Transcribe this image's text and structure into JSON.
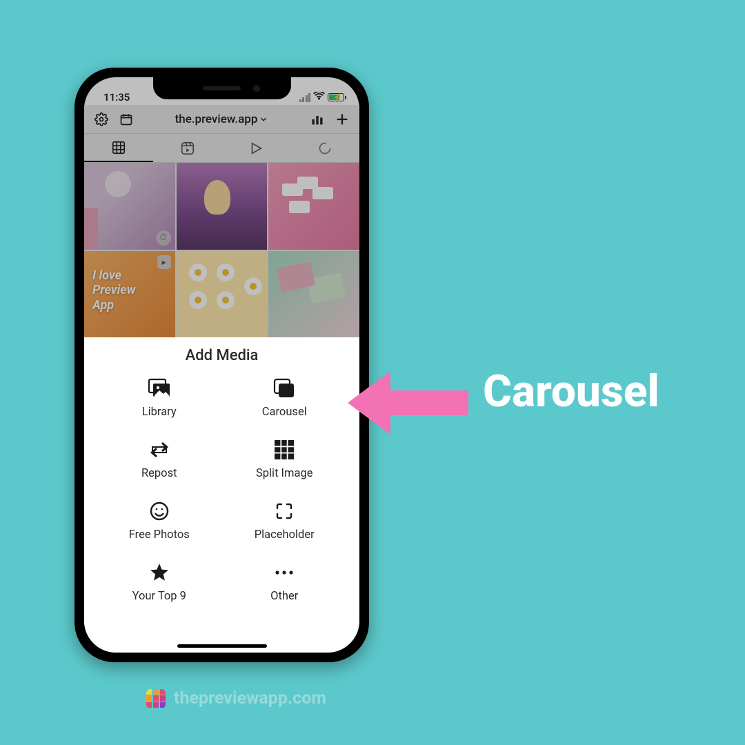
{
  "status": {
    "time": "11:35"
  },
  "toolbar": {
    "title": "the.preview.app"
  },
  "sheet": {
    "title": "Add Media",
    "items": [
      {
        "label": "Library"
      },
      {
        "label": "Carousel"
      },
      {
        "label": "Repost"
      },
      {
        "label": "Split Image"
      },
      {
        "label": "Free Photos"
      },
      {
        "label": "Placeholder"
      },
      {
        "label": "Your Top 9"
      },
      {
        "label": "Other"
      }
    ]
  },
  "feed_overlay_text": "I love\nPreview\nApp",
  "callout": {
    "label": "Carousel"
  },
  "footer": {
    "text": "thepreviewapp.com"
  }
}
